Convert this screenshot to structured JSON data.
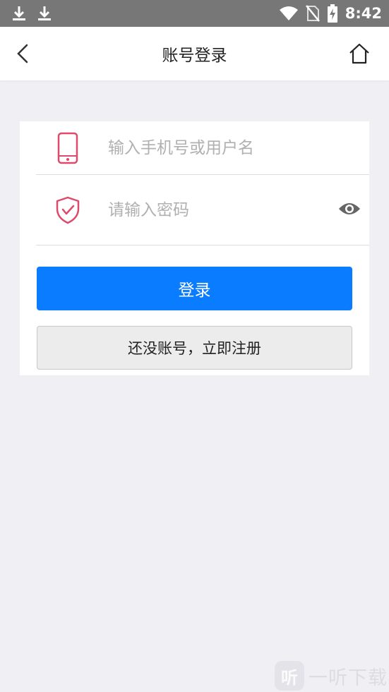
{
  "status_bar": {
    "time": "8:42",
    "left_icons": [
      "download-icon",
      "download-icon"
    ],
    "right_icons": [
      "wifi-icon",
      "no-sim-icon",
      "battery-charging-icon"
    ]
  },
  "nav": {
    "title": "账号登录",
    "back_icon": "chevron-left-icon",
    "home_icon": "home-icon"
  },
  "form": {
    "username": {
      "placeholder": "输入手机号或用户名",
      "value": "",
      "icon": "phone-icon"
    },
    "password": {
      "placeholder": "请输入密码",
      "value": "",
      "icon": "shield-check-icon",
      "toggle_icon": "eye-icon"
    },
    "login_label": "登录",
    "register_label": "还没账号，立即注册"
  },
  "colors": {
    "accent": "#0a7cff",
    "icon_red": "#e04a6a",
    "background": "#efeff4"
  },
  "watermark": {
    "logo_glyph": "听",
    "text": "一听下载"
  }
}
